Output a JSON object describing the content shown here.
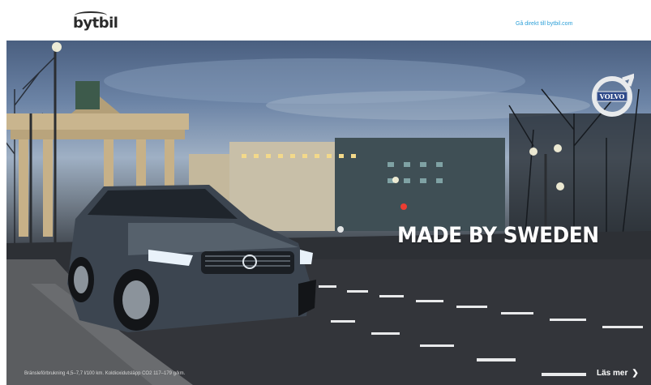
{
  "header": {
    "logo_text": "bytbil",
    "direct_link": "Gå direkt till bytbil.com"
  },
  "banner": {
    "brand_badge": "VOLVO",
    "headline": "MADE BY SWEDEN",
    "disclaimer": "Bränsleförbrukning 4,5–7,7 l/100 km. Koldioxidutsläpp CO2 117–179 g/km.",
    "cta_label": "Läs mer",
    "cta_icon": "chevron-right-icon"
  },
  "colors": {
    "link": "#2b9fd8",
    "headline": "#ffffff",
    "badge_blue": "#2f4a8a"
  }
}
